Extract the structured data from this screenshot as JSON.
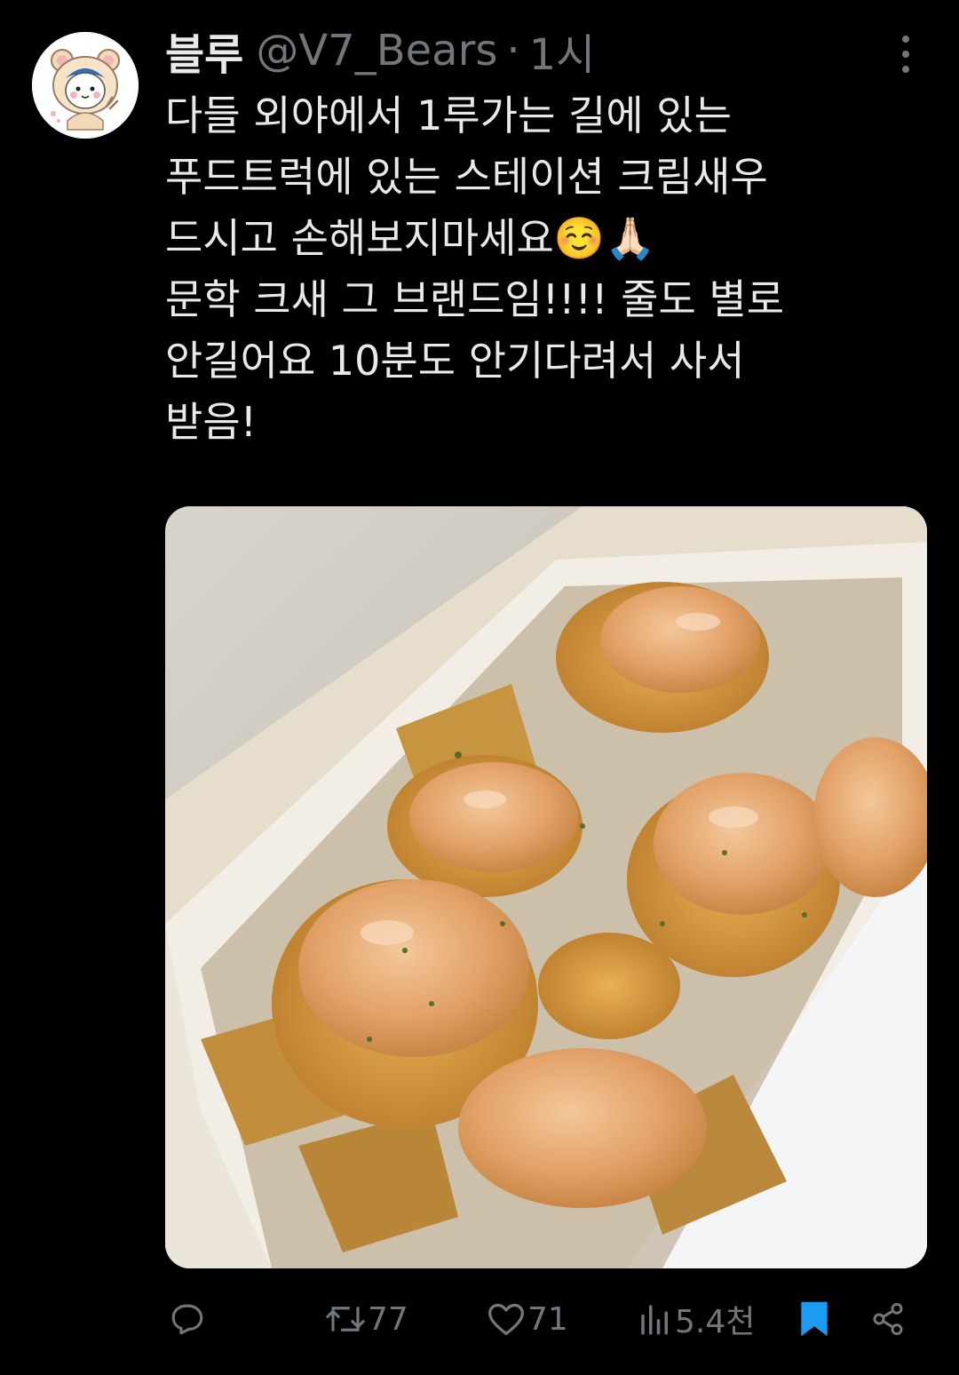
{
  "tweet": {
    "display_name": "블루",
    "handle": "@V7_Bears",
    "separator": "·",
    "time": "1시",
    "lines": [
      "다들 외야에서 1루가는 길에 있는",
      "푸드트럭에 있는 스테이션 크림새우",
      "드시고 손해보지마세요☺️🙏🏻",
      "문학 크새 그 브랜드임!!!! 줄도 별로",
      "안길어요 10분도 안기다려서 사서",
      "받음!"
    ]
  },
  "actions": {
    "reply_icon": "reply-icon",
    "retweet_icon": "retweet-icon",
    "retweet_count": "77",
    "like_icon": "heart-icon",
    "like_count": "71",
    "views_icon": "views-icon",
    "views_count": "5.4천",
    "bookmark_icon": "bookmark-icon",
    "share_icon": "share-icon"
  },
  "colors": {
    "background": "#000000",
    "text": "#e7e9ea",
    "muted": "#71767b",
    "bookmark": "#1d9bf0"
  }
}
